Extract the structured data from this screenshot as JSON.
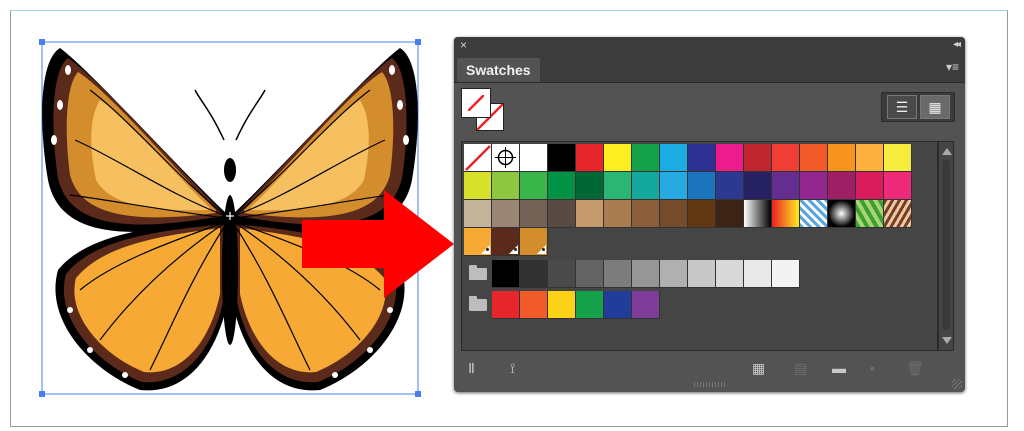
{
  "panel": {
    "title": "Swatches",
    "close_glyph": "×",
    "collapse_glyph": "◂◂",
    "menu_glyph": "▾≡",
    "list_view_glyph": "☰",
    "grid_view_glyph": "▦"
  },
  "swatch_rows": [
    [
      "none",
      "registration",
      "#ffffff",
      "#000000",
      "#e7262b",
      "#fcef20",
      "#16a24a",
      "#1aace3",
      "#2e3192",
      "#ec1c8c",
      "#c0262e",
      "#ee3e36",
      "#f15a29",
      "#f7941d",
      "#fbb040",
      "#f6ec3d"
    ],
    [
      "#d7e12c",
      "#8dc63f",
      "#39b54a",
      "#009245",
      "#006837",
      "#2bb673",
      "#15a89c",
      "#27aae1",
      "#1c75bc",
      "#2b3990",
      "#262262",
      "#662d91",
      "#92278f",
      "#9e1f63",
      "#da1c5c",
      "#ee2a7b"
    ],
    [
      "#c2b59b",
      "#998675",
      "#736357",
      "#594a42",
      "#c49a6c",
      "#a97c50",
      "#8b5e3c",
      "#754c29",
      "#603913",
      "#3c2415",
      "grad-bw",
      "grad-orange",
      "pattern-checker",
      "grad-radial",
      "pattern-leaves",
      "pattern-paisley"
    ],
    [
      "#f6a934",
      "#5b2a1a",
      "#d38d2c"
    ]
  ],
  "global_swatch_row_index": 3,
  "gray_group": [
    "#000000",
    "#323232",
    "#4a4a4a",
    "#636363",
    "#7d7d7d",
    "#969696",
    "#b0b0b0",
    "#c8c8c8",
    "#d9d9d9",
    "#e9e9e9",
    "#f3f3f3"
  ],
  "color_group": [
    "#e7262b",
    "#f15a29",
    "#fcd116",
    "#16a24a",
    "#223c9c",
    "#7d3c98"
  ],
  "bottom_icons": {
    "libraries": "Ⅱ",
    "show_kinds": "⟟",
    "new_group": "▦",
    "swatch_options": "▤",
    "new_folder": "▬",
    "new_swatch": "▪",
    "delete": "🗑"
  },
  "colors": {
    "panel_bg": "#535353",
    "panel_dark": "#3c3c3c",
    "arrow": "#ff0000",
    "selection": "#4a7df0"
  }
}
